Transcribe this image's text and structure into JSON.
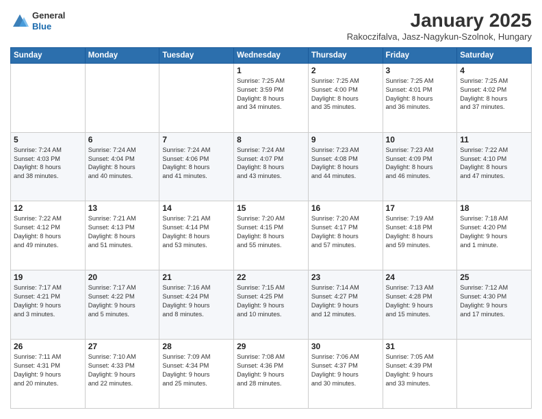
{
  "header": {
    "logo_general": "General",
    "logo_blue": "Blue",
    "month_title": "January 2025",
    "subtitle": "Rakoczifalva, Jasz-Nagykun-Szolnok, Hungary"
  },
  "days_of_week": [
    "Sunday",
    "Monday",
    "Tuesday",
    "Wednesday",
    "Thursday",
    "Friday",
    "Saturday"
  ],
  "weeks": [
    [
      {
        "day": "",
        "text": ""
      },
      {
        "day": "",
        "text": ""
      },
      {
        "day": "",
        "text": ""
      },
      {
        "day": "1",
        "text": "Sunrise: 7:25 AM\nSunset: 3:59 PM\nDaylight: 8 hours\nand 34 minutes."
      },
      {
        "day": "2",
        "text": "Sunrise: 7:25 AM\nSunset: 4:00 PM\nDaylight: 8 hours\nand 35 minutes."
      },
      {
        "day": "3",
        "text": "Sunrise: 7:25 AM\nSunset: 4:01 PM\nDaylight: 8 hours\nand 36 minutes."
      },
      {
        "day": "4",
        "text": "Sunrise: 7:25 AM\nSunset: 4:02 PM\nDaylight: 8 hours\nand 37 minutes."
      }
    ],
    [
      {
        "day": "5",
        "text": "Sunrise: 7:24 AM\nSunset: 4:03 PM\nDaylight: 8 hours\nand 38 minutes."
      },
      {
        "day": "6",
        "text": "Sunrise: 7:24 AM\nSunset: 4:04 PM\nDaylight: 8 hours\nand 40 minutes."
      },
      {
        "day": "7",
        "text": "Sunrise: 7:24 AM\nSunset: 4:06 PM\nDaylight: 8 hours\nand 41 minutes."
      },
      {
        "day": "8",
        "text": "Sunrise: 7:24 AM\nSunset: 4:07 PM\nDaylight: 8 hours\nand 43 minutes."
      },
      {
        "day": "9",
        "text": "Sunrise: 7:23 AM\nSunset: 4:08 PM\nDaylight: 8 hours\nand 44 minutes."
      },
      {
        "day": "10",
        "text": "Sunrise: 7:23 AM\nSunset: 4:09 PM\nDaylight: 8 hours\nand 46 minutes."
      },
      {
        "day": "11",
        "text": "Sunrise: 7:22 AM\nSunset: 4:10 PM\nDaylight: 8 hours\nand 47 minutes."
      }
    ],
    [
      {
        "day": "12",
        "text": "Sunrise: 7:22 AM\nSunset: 4:12 PM\nDaylight: 8 hours\nand 49 minutes."
      },
      {
        "day": "13",
        "text": "Sunrise: 7:21 AM\nSunset: 4:13 PM\nDaylight: 8 hours\nand 51 minutes."
      },
      {
        "day": "14",
        "text": "Sunrise: 7:21 AM\nSunset: 4:14 PM\nDaylight: 8 hours\nand 53 minutes."
      },
      {
        "day": "15",
        "text": "Sunrise: 7:20 AM\nSunset: 4:15 PM\nDaylight: 8 hours\nand 55 minutes."
      },
      {
        "day": "16",
        "text": "Sunrise: 7:20 AM\nSunset: 4:17 PM\nDaylight: 8 hours\nand 57 minutes."
      },
      {
        "day": "17",
        "text": "Sunrise: 7:19 AM\nSunset: 4:18 PM\nDaylight: 8 hours\nand 59 minutes."
      },
      {
        "day": "18",
        "text": "Sunrise: 7:18 AM\nSunset: 4:20 PM\nDaylight: 9 hours\nand 1 minute."
      }
    ],
    [
      {
        "day": "19",
        "text": "Sunrise: 7:17 AM\nSunset: 4:21 PM\nDaylight: 9 hours\nand 3 minutes."
      },
      {
        "day": "20",
        "text": "Sunrise: 7:17 AM\nSunset: 4:22 PM\nDaylight: 9 hours\nand 5 minutes."
      },
      {
        "day": "21",
        "text": "Sunrise: 7:16 AM\nSunset: 4:24 PM\nDaylight: 9 hours\nand 8 minutes."
      },
      {
        "day": "22",
        "text": "Sunrise: 7:15 AM\nSunset: 4:25 PM\nDaylight: 9 hours\nand 10 minutes."
      },
      {
        "day": "23",
        "text": "Sunrise: 7:14 AM\nSunset: 4:27 PM\nDaylight: 9 hours\nand 12 minutes."
      },
      {
        "day": "24",
        "text": "Sunrise: 7:13 AM\nSunset: 4:28 PM\nDaylight: 9 hours\nand 15 minutes."
      },
      {
        "day": "25",
        "text": "Sunrise: 7:12 AM\nSunset: 4:30 PM\nDaylight: 9 hours\nand 17 minutes."
      }
    ],
    [
      {
        "day": "26",
        "text": "Sunrise: 7:11 AM\nSunset: 4:31 PM\nDaylight: 9 hours\nand 20 minutes."
      },
      {
        "day": "27",
        "text": "Sunrise: 7:10 AM\nSunset: 4:33 PM\nDaylight: 9 hours\nand 22 minutes."
      },
      {
        "day": "28",
        "text": "Sunrise: 7:09 AM\nSunset: 4:34 PM\nDaylight: 9 hours\nand 25 minutes."
      },
      {
        "day": "29",
        "text": "Sunrise: 7:08 AM\nSunset: 4:36 PM\nDaylight: 9 hours\nand 28 minutes."
      },
      {
        "day": "30",
        "text": "Sunrise: 7:06 AM\nSunset: 4:37 PM\nDaylight: 9 hours\nand 30 minutes."
      },
      {
        "day": "31",
        "text": "Sunrise: 7:05 AM\nSunset: 4:39 PM\nDaylight: 9 hours\nand 33 minutes."
      },
      {
        "day": "",
        "text": ""
      }
    ]
  ]
}
